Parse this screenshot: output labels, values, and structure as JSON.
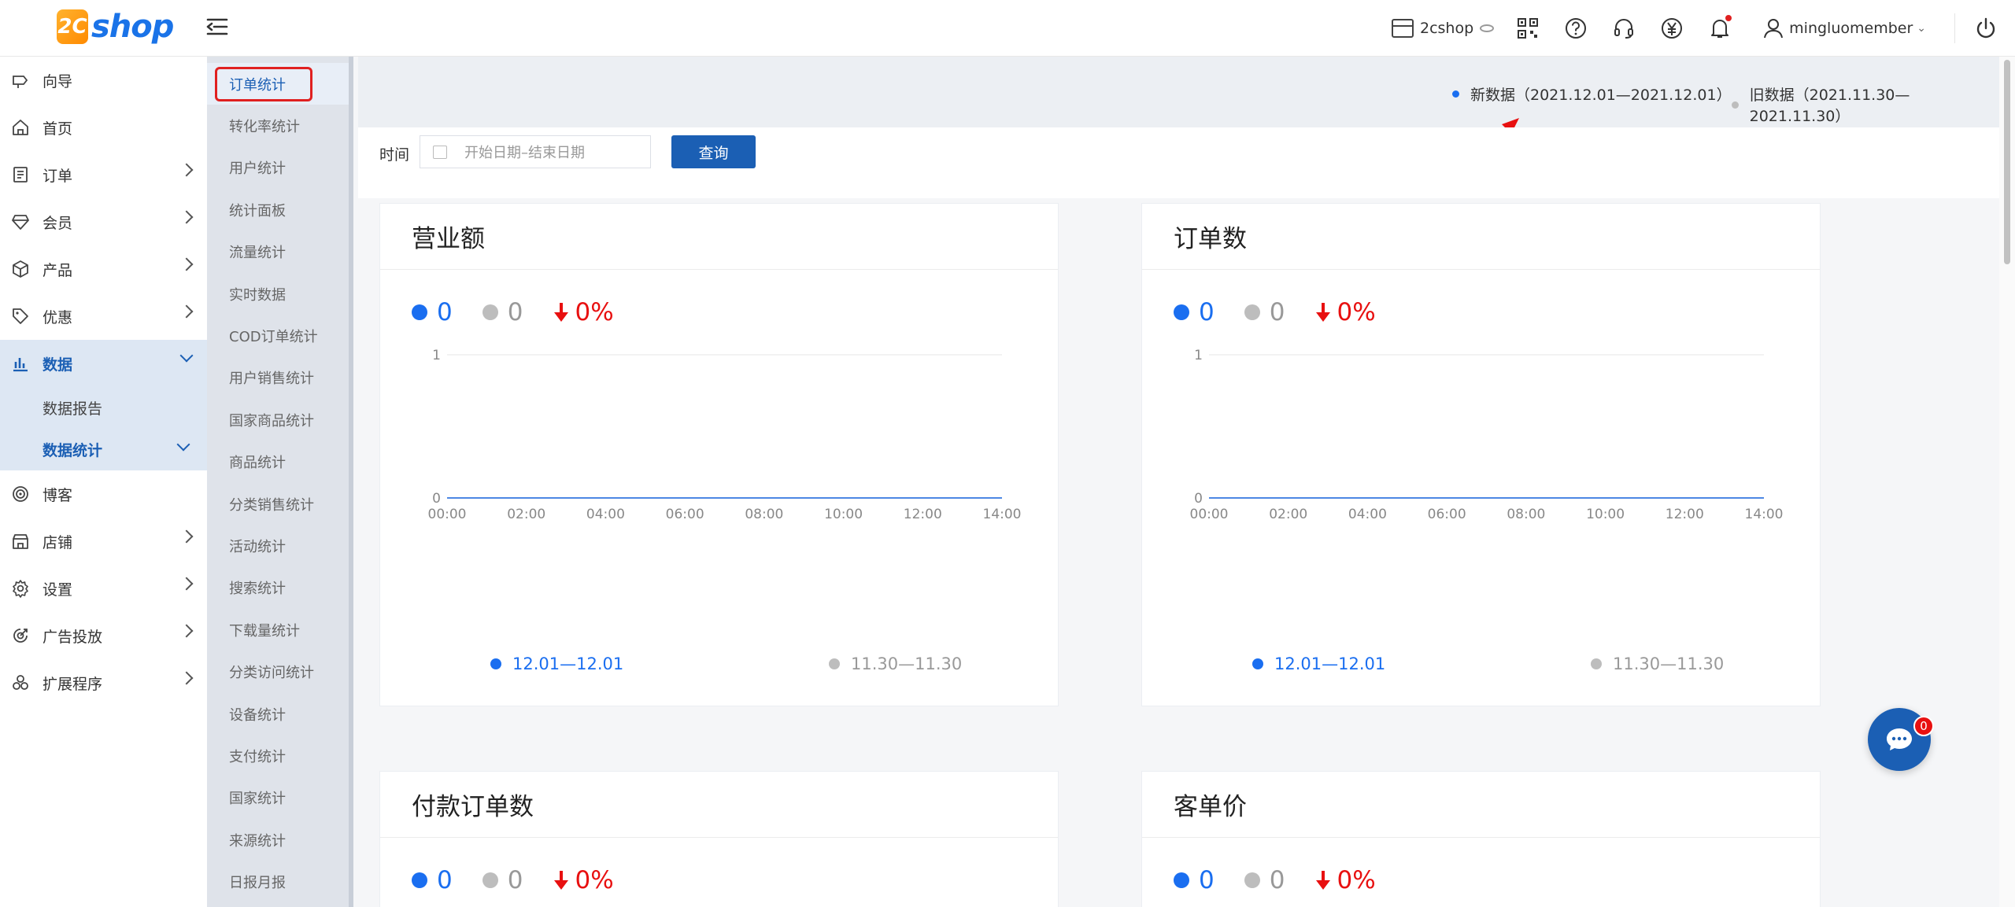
{
  "brand": {
    "logo_mark": "2C",
    "logo_text": "shop"
  },
  "topbar": {
    "shop_name": "2cshop",
    "icons": [
      "qr-code-icon",
      "help-icon",
      "headset-icon",
      "yen-icon",
      "bell-icon"
    ],
    "username": "mingluomember"
  },
  "sidebar": {
    "items": [
      {
        "label": "向导",
        "icon": "guide-icon"
      },
      {
        "label": "首页",
        "icon": "home-icon"
      },
      {
        "label": "订单",
        "icon": "order-icon"
      },
      {
        "label": "会员",
        "icon": "member-icon"
      },
      {
        "label": "产品",
        "icon": "product-icon"
      },
      {
        "label": "优惠",
        "icon": "tag-icon"
      },
      {
        "label": "数据",
        "icon": "chart-icon"
      },
      {
        "label": "博客",
        "icon": "blog-icon"
      },
      {
        "label": "店铺",
        "icon": "store-icon"
      },
      {
        "label": "设置",
        "icon": "gear-icon"
      },
      {
        "label": "广告投放",
        "icon": "ads-icon"
      },
      {
        "label": "扩展程序",
        "icon": "extension-icon"
      }
    ],
    "sub_items": [
      "数据报告",
      "数据统计"
    ]
  },
  "subnav": {
    "items": [
      "订单统计",
      "转化率统计",
      "用户统计",
      "统计面板",
      "流量统计",
      "实时数据",
      "COD订单统计",
      "用户销售统计",
      "国家商品统计",
      "商品统计",
      "分类销售统计",
      "活动统计",
      "搜索统计",
      "下载量统计",
      "分类访问统计",
      "设备统计",
      "支付统计",
      "国家统计",
      "来源统计",
      "日报月报"
    ]
  },
  "legend": {
    "new_label": "新数据（2021.12.01—2021.12.01）",
    "old_label": "旧数据（2021.11.30—2021.11.30）"
  },
  "filter": {
    "label": "时间",
    "date_placeholder": "开始日期–结束日期",
    "query_button": "查询"
  },
  "colors": {
    "primary": "#1b5fb4",
    "current": "#1a6ef0",
    "previous": "#bdbdbd",
    "decline": "#e81010"
  },
  "cards": [
    {
      "title": "营业额",
      "current": "0",
      "previous": "0",
      "change": "0%"
    },
    {
      "title": "订单数",
      "current": "0",
      "previous": "0",
      "change": "0%"
    },
    {
      "title": "付款订单数",
      "current": "0",
      "previous": "0",
      "change": "0%"
    },
    {
      "title": "客单价",
      "current": "0",
      "previous": "0",
      "change": "0%"
    }
  ],
  "chart_data": [
    {
      "type": "line",
      "x": [
        "00:00",
        "02:00",
        "04:00",
        "06:00",
        "08:00",
        "10:00",
        "12:00",
        "14:00"
      ],
      "yticks": [
        "1",
        "0"
      ],
      "ylim": [
        0,
        1
      ],
      "series": [
        {
          "name": "12.01—12.01",
          "values": [
            0,
            0,
            0,
            0,
            0,
            0,
            0,
            0
          ]
        },
        {
          "name": "11.30—11.30",
          "values": [
            0,
            0,
            0,
            0,
            0,
            0,
            0,
            0
          ]
        }
      ]
    },
    {
      "type": "line",
      "x": [
        "00:00",
        "02:00",
        "04:00",
        "06:00",
        "08:00",
        "10:00",
        "12:00",
        "14:00"
      ],
      "yticks": [
        "1",
        "0"
      ],
      "ylim": [
        0,
        1
      ],
      "series": [
        {
          "name": "12.01—12.01",
          "values": [
            0,
            0,
            0,
            0,
            0,
            0,
            0,
            0
          ]
        },
        {
          "name": "11.30—11.30",
          "values": [
            0,
            0,
            0,
            0,
            0,
            0,
            0,
            0
          ]
        }
      ]
    }
  ],
  "chat": {
    "badge_count": "0"
  }
}
